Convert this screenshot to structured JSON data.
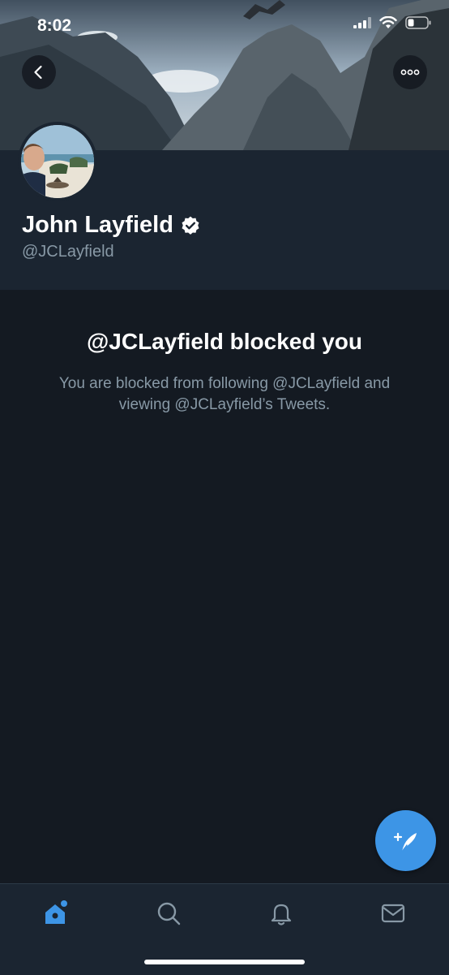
{
  "status_bar": {
    "time": "8:02"
  },
  "profile": {
    "display_name": "John Layfield",
    "handle": "@JCLayfield",
    "verified": true
  },
  "blocked": {
    "title": "@JCLayfield blocked you",
    "description": "You are blocked from following @JCLayfield and viewing @JCLayfield’s Tweets."
  },
  "icons": {
    "back": "back-arrow-icon",
    "more": "more-options-icon",
    "compose": "compose-tweet-icon",
    "home": "home-icon",
    "search": "search-icon",
    "notifications": "bell-icon",
    "messages": "mail-icon"
  },
  "colors": {
    "accent": "#3d95e6",
    "background": "#141a22",
    "panel": "#1b2531",
    "muted_text": "#8899a6"
  }
}
